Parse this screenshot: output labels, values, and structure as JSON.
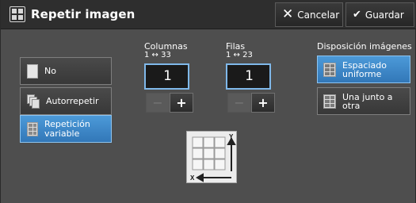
{
  "header": {
    "title": "Repetir imagen",
    "cancel_label": "Cancelar",
    "save_label": "Guardar"
  },
  "options": [
    {
      "label": "No",
      "icon": "document-icon",
      "selected": false
    },
    {
      "label": "Autorrepetir",
      "icon": "auto-repeat-icon",
      "selected": false
    },
    {
      "label": "Repetición variable",
      "icon": "variable-repeat-icon",
      "selected": true
    }
  ],
  "columns": {
    "title": "Columnas",
    "range": "1 ↔ 33",
    "value": "1"
  },
  "rows": {
    "title": "Filas",
    "range": "1 ↔ 23",
    "value": "1"
  },
  "layout": {
    "title": "Disposición imágenes",
    "options": [
      {
        "label": "Espaciado uniforme",
        "selected": true
      },
      {
        "label": "Una junto a otra",
        "selected": false
      }
    ]
  },
  "diagram": {
    "x_label": "X",
    "y_label": "Y"
  },
  "colors": {
    "selected": "#3f89c9",
    "header": "#2e2e2e",
    "background": "#4e4e4e"
  }
}
